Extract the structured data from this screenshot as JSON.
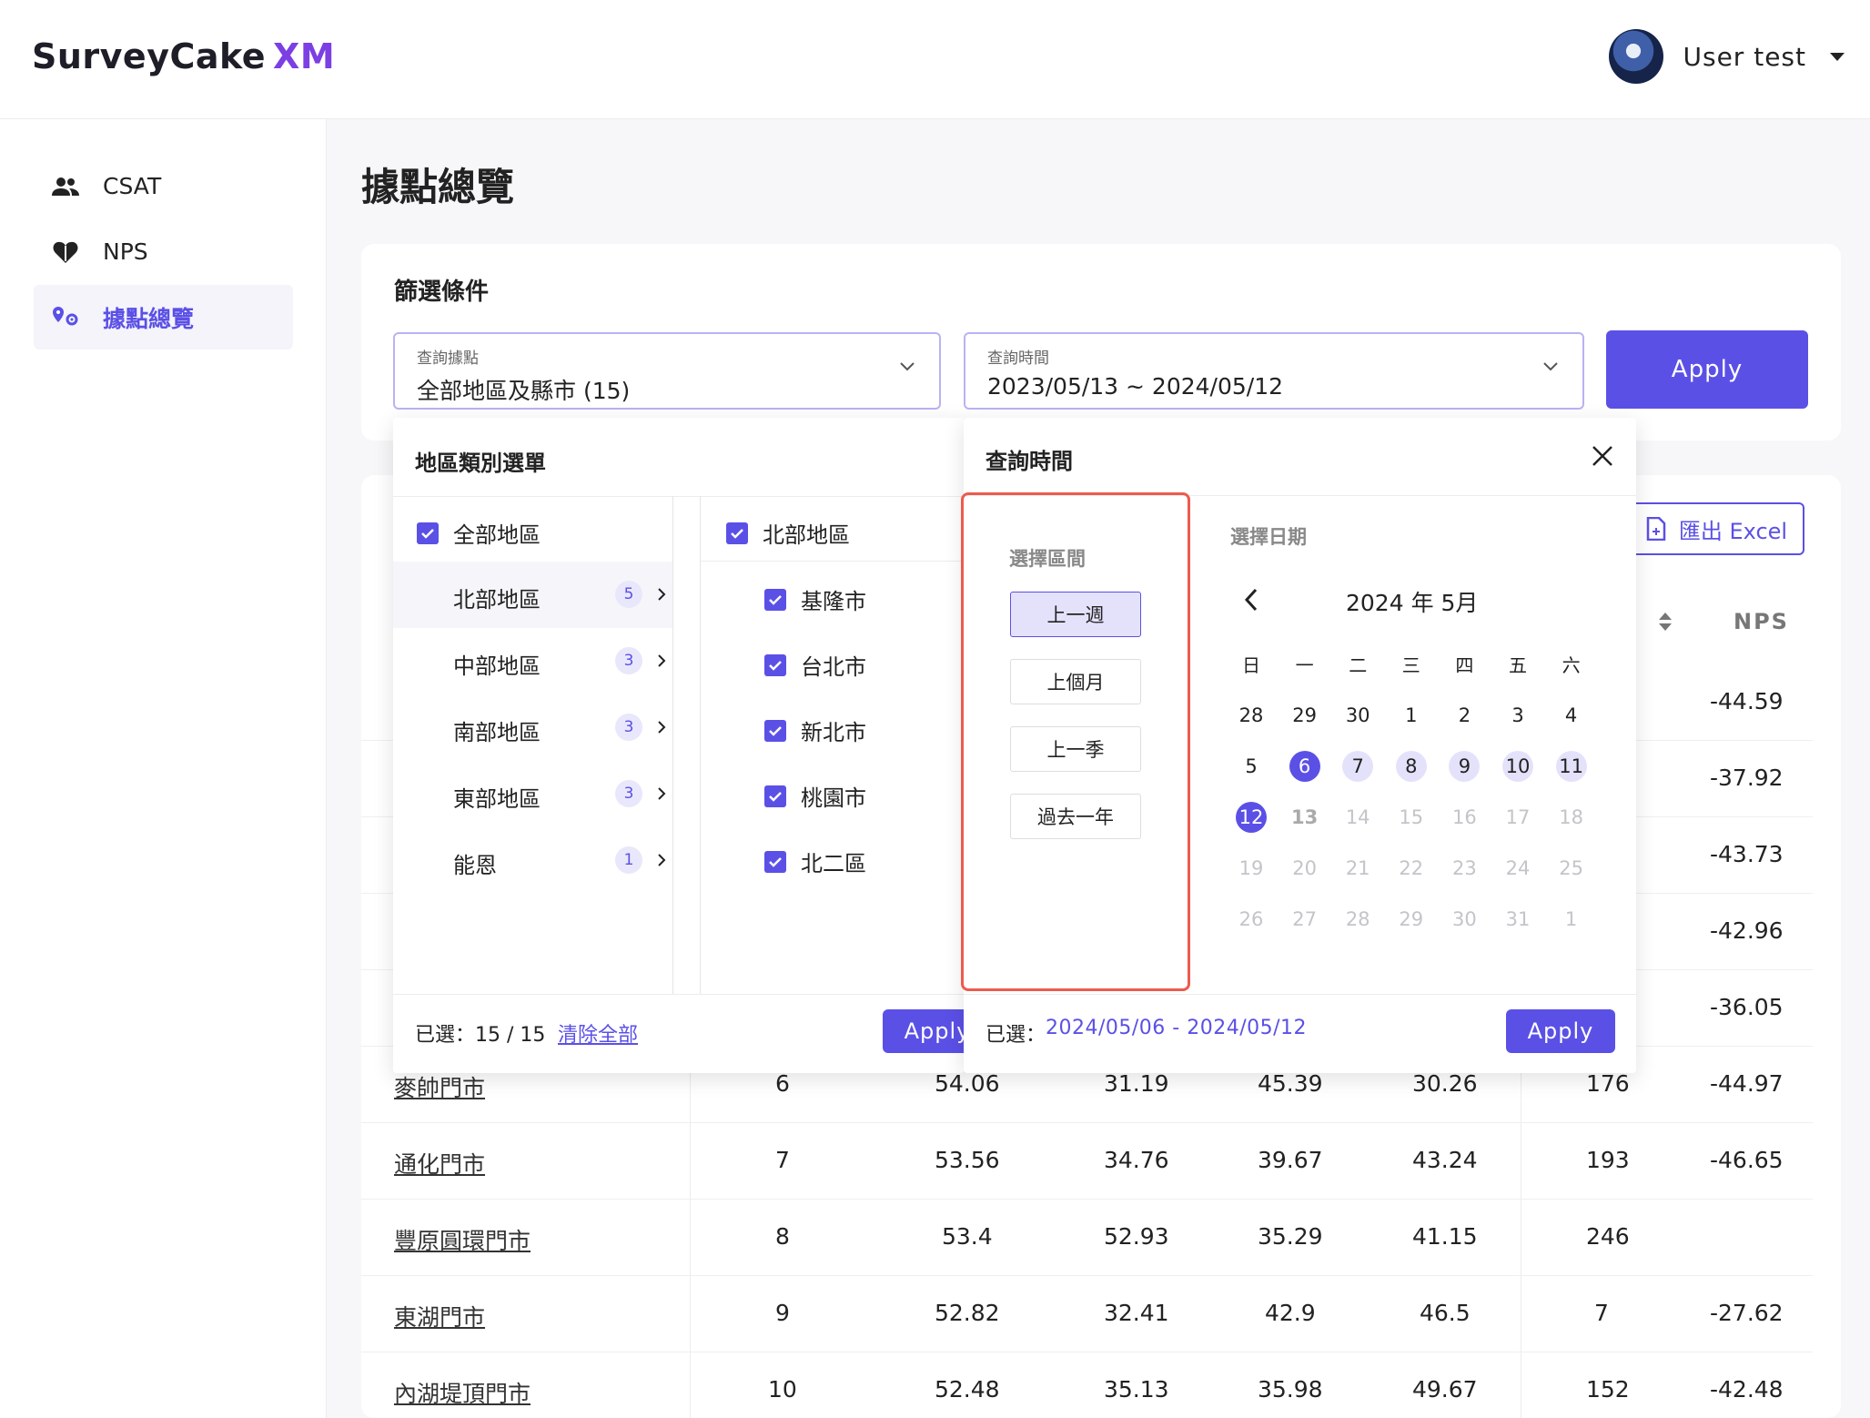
{
  "header": {
    "logo_text": "SurveyCake",
    "logo_xm": "XM",
    "user_name": "User test"
  },
  "sidebar": {
    "items": [
      {
        "label": "CSAT",
        "icon": "people-icon"
      },
      {
        "label": "NPS",
        "icon": "heart-icon"
      },
      {
        "label": "據點總覽",
        "icon": "location-pin-icon"
      }
    ]
  },
  "page": {
    "title": "據點總覽"
  },
  "filter": {
    "title": "篩選條件",
    "location_label": "查詢據點",
    "location_value": "全部地區及縣市 (15)",
    "time_label": "查詢時間",
    "time_value": "2023/05/13 ~ 2024/05/12",
    "apply_label": "Apply"
  },
  "table": {
    "export_label": "匯出 Excel",
    "nps_header": "NPS",
    "partial_nps": [
      "-44.59",
      "-37.92",
      "-43.73",
      "-42.96",
      "-36.05"
    ],
    "rows": [
      {
        "store": "麥帥門市",
        "rank": "6",
        "c1": "54.06",
        "c2": "31.19",
        "c3": "45.39",
        "c4": "30.26",
        "count": "176",
        "nps": "-44.97"
      },
      {
        "store": "通化門市",
        "rank": "7",
        "c1": "53.56",
        "c2": "34.76",
        "c3": "39.67",
        "c4": "43.24",
        "count": "193",
        "nps": "-46.65"
      },
      {
        "store": "豐原圓環門市",
        "rank": "8",
        "c1": "53.4",
        "c2": "52.93",
        "c3": "35.29",
        "c4": "41.15",
        "count": "246",
        "nps": ""
      },
      {
        "store": "東湖門市",
        "rank": "9",
        "c1": "52.82",
        "c2": "32.41",
        "c3": "42.9",
        "c4": "46.5",
        "count": "7",
        "nps": "-27.62"
      },
      {
        "store": "內湖堤頂門市",
        "rank": "10",
        "c1": "52.48",
        "c2": "35.13",
        "c3": "35.98",
        "c4": "49.67",
        "count": "152",
        "nps": "-42.48"
      }
    ]
  },
  "region_popup": {
    "title": "地區類別選單",
    "all_label": "全部地區",
    "regions": [
      {
        "label": "北部地區",
        "count": "5"
      },
      {
        "label": "中部地區",
        "count": "3"
      },
      {
        "label": "南部地區",
        "count": "3"
      },
      {
        "label": "東部地區",
        "count": "3"
      },
      {
        "label": "能恩",
        "count": "1"
      }
    ],
    "sub_header": "北部地區",
    "sub_items": [
      "基隆市",
      "台北市",
      "新北市",
      "桃園市",
      "北二區"
    ],
    "selected_text": "已選：15 / 15",
    "clear_label": "清除全部",
    "apply_label": "Apply"
  },
  "date_popup": {
    "title": "查詢時間",
    "preset_title": "選擇區間",
    "presets": [
      "上一週",
      "上個月",
      "上一季",
      "過去一年"
    ],
    "calendar_title": "選擇日期",
    "month_label": "2024 年 5月",
    "weekdays": [
      "日",
      "一",
      "二",
      "三",
      "四",
      "五",
      "六"
    ],
    "weeks": [
      [
        "28",
        "29",
        "30",
        "1",
        "2",
        "3",
        "4"
      ],
      [
        "5",
        "6",
        "7",
        "8",
        "9",
        "10",
        "11"
      ],
      [
        "12",
        "13",
        "14",
        "15",
        "16",
        "17",
        "18"
      ],
      [
        "19",
        "20",
        "21",
        "22",
        "23",
        "24",
        "25"
      ],
      [
        "26",
        "27",
        "28",
        "29",
        "30",
        "31",
        "1"
      ]
    ],
    "selected_prefix": "已選：",
    "selected_range": "2024/05/06 - 2024/05/12",
    "apply_label": "Apply",
    "colors": {
      "accent": "#5b50e6",
      "range_bg": "#e4e2fb",
      "highlight_border": "#ec5b4e"
    }
  }
}
